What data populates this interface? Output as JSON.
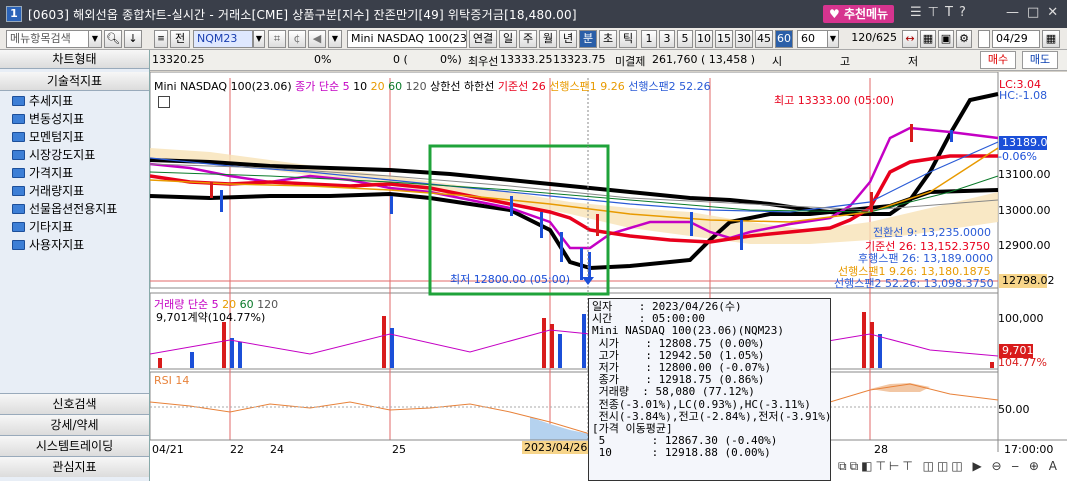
{
  "titlebar": {
    "num": "1",
    "title": "[0603] 해외선옵 종합차트-실시간 - 거래소[CME] 상품구분[지수] 잔존만기[49] 위탁증거금[18,480.00]",
    "recommend_menu": "추천메뉴"
  },
  "toolbar": {
    "menu_search": "메뉴항목검색",
    "jeon": "전",
    "code": "NQM23",
    "product": "Mini NASDAQ 100(23.0",
    "link": "연결",
    "periods": [
      "일",
      "주",
      "월",
      "년",
      "분",
      "초",
      "틱"
    ],
    "selected_period": "분",
    "minutes": [
      "1",
      "3",
      "5",
      "10",
      "15",
      "30",
      "45",
      "60"
    ],
    "selected_minute": "60",
    "minute_value": "60",
    "count": "120",
    "total": "/625",
    "date": "04/29"
  },
  "infobar": {
    "price": "13320.25",
    "pct": "0%",
    "zero": "0 (",
    "pct2": "0%)",
    "best_ask_label": "최우선",
    "best_ask": "13333.25",
    "best_bid": "13323.75",
    "open_interest_label": "미결제",
    "open_interest": "261,760 ( 13,458 )",
    "si": "시",
    "go": "고",
    "jeo": "저",
    "buy": "매수",
    "sell": "매도"
  },
  "sidebar": {
    "chart_type": "차트형태",
    "technical": "기술적지표",
    "items": [
      "추세지표",
      "변동성지표",
      "모멘텀지표",
      "시장강도지표",
      "가격지표",
      "거래량지표",
      "선물옵션전용지표",
      "기타지표",
      "사용자지표"
    ],
    "bottom": [
      "신호검색",
      "강세/약세",
      "시스템트레이딩",
      "관심지표"
    ]
  },
  "price_legend": {
    "product": "Mini NASDAQ 100(23.06)",
    "close_ma": "종가 단순",
    "ma_periods": [
      "5",
      "10",
      "20",
      "60",
      "120"
    ],
    "upper": "상한선",
    "lower": "하한선",
    "base": "기준선 26",
    "lead1": "선행스팬1 9.26",
    "lead2": "선행스팬2 52.26",
    "lc": "LC:3.04",
    "hc": "HC:-1.08"
  },
  "annotations": {
    "high": "최고 13333.00 (05:00)",
    "low": "최저 12800.00 (05:00)",
    "conv": "전환선 9: 13,235.0000",
    "base": "기준선 26: 13,152.3750",
    "lag": "후행스팬 26: 13,189.0000",
    "lead1": "선행스팬1 9.26: 13,180.1875",
    "lead2": "선행스팬2 52.26: 13,098.3750"
  },
  "price_axis": {
    "ticks": [
      "13189.00",
      "13100.00",
      "13000.00",
      "12900.00"
    ],
    "current": "13189.00",
    "current_pct": "-0.06%",
    "low_tag": "12798.02"
  },
  "volume_legend": {
    "label": "거래량",
    "simple": "단순",
    "periods": [
      "5",
      "20",
      "60",
      "120"
    ],
    "contracts": "9,701계약(104.77%)",
    "tick": "100,000",
    "tick2": "50,000",
    "current": "9,701",
    "current_pct": "104.77%"
  },
  "rsi": {
    "label": "RSI 14",
    "tick": "50.00"
  },
  "xaxis": {
    "labels": [
      "04/21",
      "22",
      "24",
      "25",
      "26",
      "28"
    ],
    "cursor_date": "2023/04/26",
    "time_label": "17:00:00"
  },
  "popup": {
    "lines": [
      "일자    : 2023/04/26(수)",
      "시간    : 05:00:00",
      "Mini NASDAQ 100(23.06)(NQM23)",
      " 시가    : 12808.75 (0.00%)",
      " 고가    : 12942.50 (1.05%)",
      " 저가    : 12800.00 (-0.07%)",
      " 종가    : 12918.75 (0.86%)",
      " 거래량  : 58,080 (77.12%)",
      " 전종(-3.01%),LC(0.93%),HC(-3.11%)",
      " 전시(-3.84%),전고(-2.84%),전저(-3.91%)",
      "[가격 이동평균]",
      " 5       : 12867.30 (-0.40%)",
      " 10      : 12918.88 (0.00%)"
    ]
  },
  "colors": {
    "title_bg": "#3a3f4a",
    "accent_pink": "#d6348f",
    "ma_red": "#e8001c",
    "ma_magenta": "#c400c4",
    "ma_black": "#000000",
    "volume_red": "#d81b1b",
    "volume_blue": "#1b4fd8",
    "rsi_orange": "#e8823a",
    "highlight_green": "#1fa33a"
  }
}
